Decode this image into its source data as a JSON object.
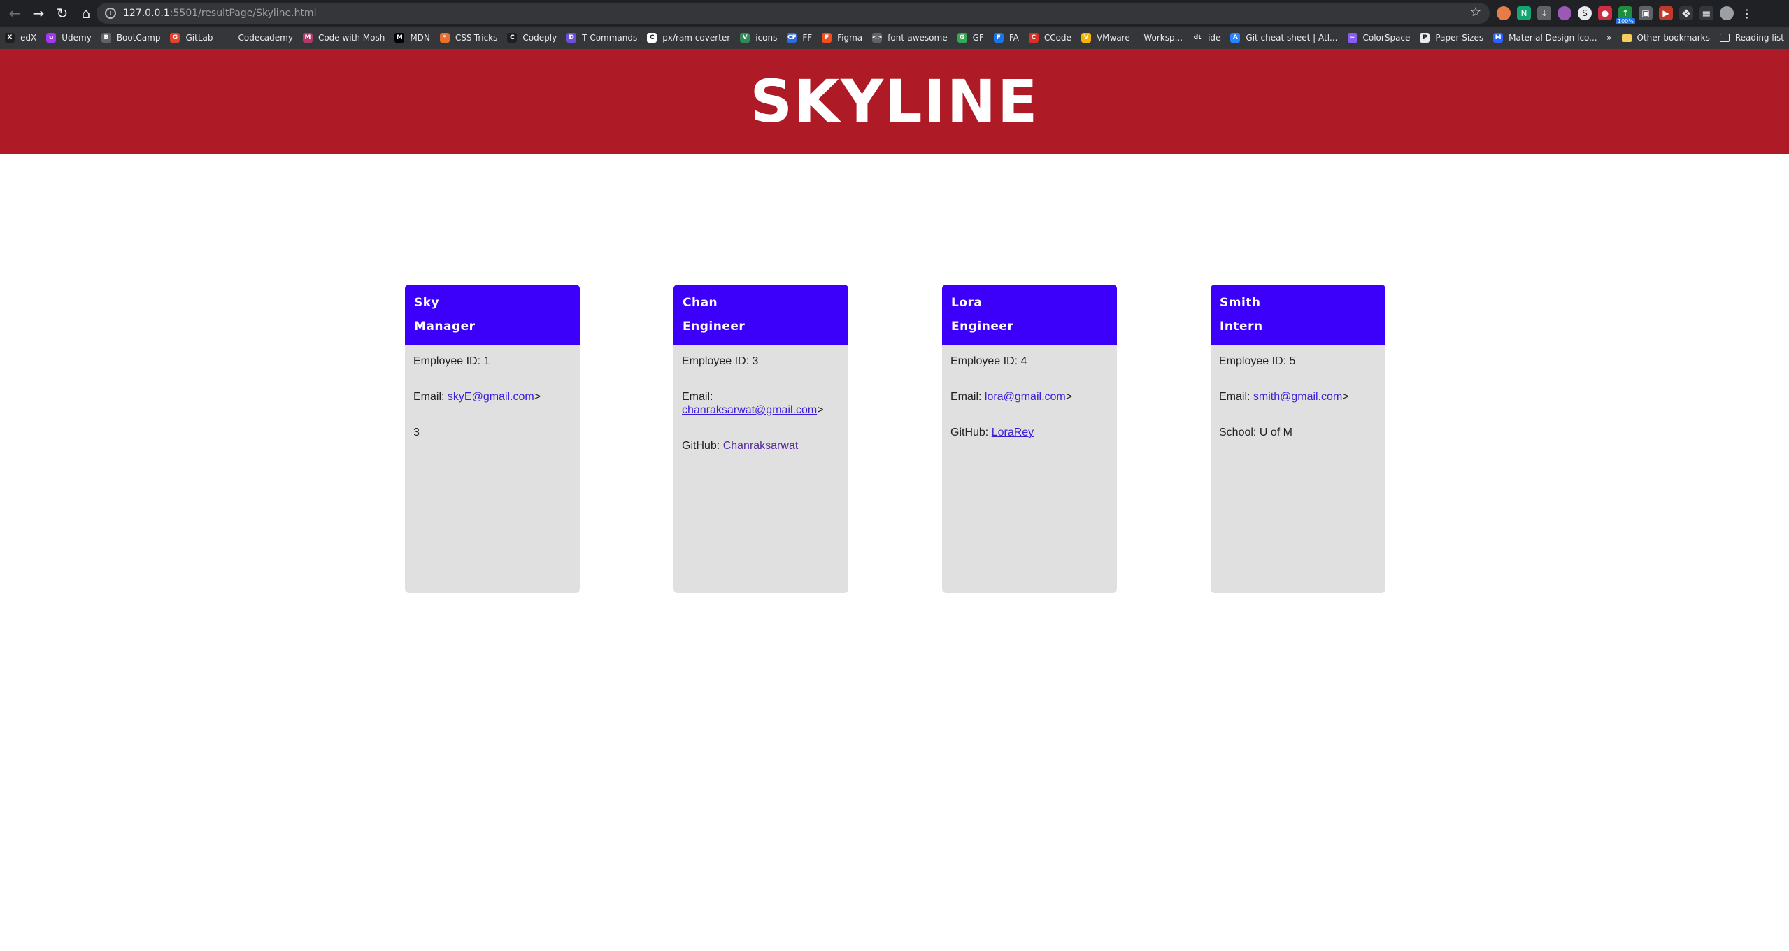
{
  "browser": {
    "url_host": "127.0.0.1",
    "url_path": ":5501/resultPage/Skyline.html",
    "bookmarks": [
      {
        "label": "edX",
        "color": "#1f1f1f",
        "glyph": "X"
      },
      {
        "label": "Udemy",
        "color": "#a435f0",
        "glyph": "u"
      },
      {
        "label": "BootCamp",
        "color": "#5f6368",
        "glyph": "B"
      },
      {
        "label": "GitLab",
        "color": "#e2432a",
        "glyph": "G"
      },
      {
        "label": "Codecademy",
        "color": "#35363a",
        "glyph": ""
      },
      {
        "label": "Code with Mosh",
        "color": "#b03a6a",
        "glyph": "M"
      },
      {
        "label": "MDN",
        "color": "#000000",
        "glyph": "M"
      },
      {
        "label": "CSS-Tricks",
        "color": "#e76f30",
        "glyph": "*"
      },
      {
        "label": "Codeply",
        "color": "#1f1f1f",
        "glyph": "C"
      },
      {
        "label": "T Commands",
        "color": "#6b4fd8",
        "glyph": "D"
      },
      {
        "label": "px/ram coverter",
        "color": "#ffffff",
        "glyph": "C"
      },
      {
        "label": "icons",
        "color": "#2e8b57",
        "glyph": "V"
      },
      {
        "label": "FF",
        "color": "#2d6cdf",
        "glyph": "CF"
      },
      {
        "label": "Figma",
        "color": "#f24e1e",
        "glyph": "F"
      },
      {
        "label": "font-awesome",
        "color": "#5f6368",
        "glyph": "<>"
      },
      {
        "label": "GF",
        "color": "#34a853",
        "glyph": "G"
      },
      {
        "label": "FA",
        "color": "#1a73e8",
        "glyph": "F"
      },
      {
        "label": "CCode",
        "color": "#d93025",
        "glyph": "C"
      },
      {
        "label": "VMware — Worksp...",
        "color": "#f4b400",
        "glyph": "V"
      },
      {
        "label": "ide",
        "color": "#35363a",
        "glyph": "dt"
      },
      {
        "label": "Git cheat sheet | Atl...",
        "color": "#2684ff",
        "glyph": "A"
      },
      {
        "label": "ColorSpace",
        "color": "#8a5cf6",
        "glyph": "~"
      },
      {
        "label": "Paper Sizes",
        "color": "#e8eaed",
        "glyph": "P"
      },
      {
        "label": "Material Design Ico...",
        "color": "#2962ff",
        "glyph": "M"
      }
    ],
    "more_chevron": "»",
    "other_bookmarks": "Other bookmarks",
    "reading_list": "Reading list",
    "ext_badge": "100%"
  },
  "page": {
    "title": "SKYLINE",
    "cards": [
      {
        "name": "Sky",
        "role": "Manager",
        "id_label": "Employee ID: 1",
        "email_label": "Email: ",
        "email": "skyE@gmail.com",
        "email_suffix": ">",
        "extra_plain": "3"
      },
      {
        "name": "Chan",
        "role": "Engineer",
        "id_label": "Employee ID: 3",
        "email_label": "Email: ",
        "email": "chanraksarwat@gmail.com",
        "email_suffix": ">",
        "extra_label": "GitHub: ",
        "extra_link": "Chanraksarwat"
      },
      {
        "name": "Lora",
        "role": "Engineer",
        "id_label": "Employee ID: 4",
        "email_label": "Email: ",
        "email": "lora@gmail.com",
        "email_suffix": ">",
        "extra_label": "GitHub: ",
        "extra_link": "LoraRey"
      },
      {
        "name": "Smith",
        "role": "Intern",
        "id_label": "Employee ID: 5",
        "email_label": "Email: ",
        "email": "smith@gmail.com",
        "email_suffix": ">",
        "extra_plain": "School: U of M"
      }
    ]
  },
  "colors": {
    "header_bg": "#ae1a26",
    "card_head_bg": "#3c00fa",
    "card_body_bg": "#e0e0e0"
  }
}
